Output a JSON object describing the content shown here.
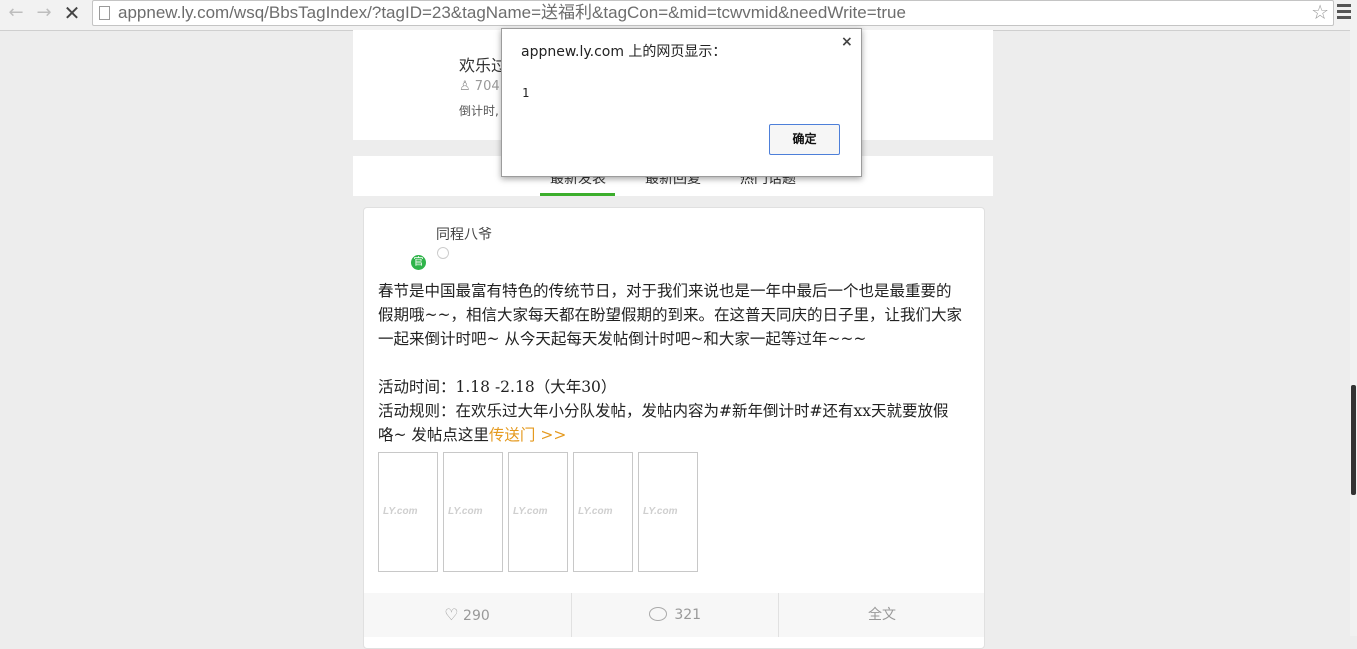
{
  "browser": {
    "url": "appnew.ly.com/wsq/BbsTagIndex/?tagID=23&tagName=送福利&tagCon=&mid=tcwvmid&needWrite=true",
    "back_glyph": "←",
    "forward_glyph": "→",
    "stop_glyph": "✕",
    "star_glyph": "☆"
  },
  "header": {
    "group_name": "欢乐过",
    "members": "704",
    "countdown_prefix": "倒计时,"
  },
  "tabs": [
    {
      "label": "最新发表",
      "active": true
    },
    {
      "label": "最新回复",
      "active": false
    },
    {
      "label": "热门话题",
      "active": false
    }
  ],
  "post": {
    "badge": "官",
    "author": "同程八爷",
    "paragraph1": "春节是中国最富有特色的传统节日，对于我们来说也是一年中最后一个也是最重要的假期哦~~，相信大家每天都在盼望假期的到来。在这普天同庆的日子里，让我们大家一起来倒计时吧~ 从今天起每天发帖倒计时吧~和大家一起等过年~~~",
    "time_line": "活动时间：1.18 -2.18（大年30）",
    "rule_line": "活动规则：在欢乐过大年小分队发帖，发帖内容为#新年倒计时#还有xx天就要放假咯~ 发帖点这里",
    "link_text": "传送门 >>",
    "thumb_logo": "LY.com",
    "likes": "290",
    "comments": "321",
    "full_text": "全文"
  },
  "dialog": {
    "title": "appnew.ly.com 上的网页显示：",
    "close": "×",
    "message": "1",
    "ok_label": "确定"
  },
  "colors": {
    "accent_green": "#3cae2c",
    "link_orange": "#e59a1f",
    "dialog_button_border": "#4d7fd9"
  }
}
